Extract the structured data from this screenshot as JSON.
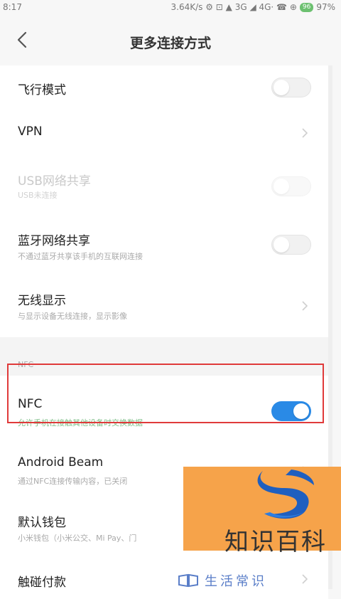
{
  "status": {
    "time": "8:17",
    "indicators": "3.64K/s ⚙ ⊡ ▲ 3G ◢ 4G· ☎ ⊕",
    "battery_badge": "96",
    "battery": "97%"
  },
  "header": {
    "title": "更多连接方式"
  },
  "rows": [
    {
      "label": "飞行模式",
      "control": "toggle",
      "state": "off"
    },
    {
      "label": "VPN",
      "control": "chevron"
    },
    {
      "label": "USB网络共享",
      "sub": "USB未连接",
      "control": "toggle",
      "state": "off",
      "disabled": true
    },
    {
      "label": "蓝牙网络共享",
      "sub": "不通过蓝牙共享该手机的互联网连接",
      "control": "toggle",
      "state": "off"
    },
    {
      "label": "无线显示",
      "sub": "与显示设备无线连接，显示影像",
      "control": "chevron"
    }
  ],
  "nfc_section": {
    "title": "NFC",
    "rows": [
      {
        "label": "NFC",
        "sub": "允许手机在接触其他设备时交换数据",
        "control": "toggle",
        "state": "on"
      },
      {
        "label": "Android Beam",
        "sub": "通过NFC连接传输内容，已关闭",
        "control": "chevron"
      },
      {
        "label": "默认钱包",
        "sub": "小米钱包（小米公交、Mi Pay、门",
        "control": "chevron"
      },
      {
        "label": "触碰付款",
        "control": "chevron"
      }
    ]
  },
  "watermark": {
    "text": "知识百科",
    "bottom_text": "生活常识"
  },
  "colors": {
    "accent": "#2a8ae6",
    "highlight": "#e03a3a",
    "watermark_bg": "#f6a34a"
  }
}
